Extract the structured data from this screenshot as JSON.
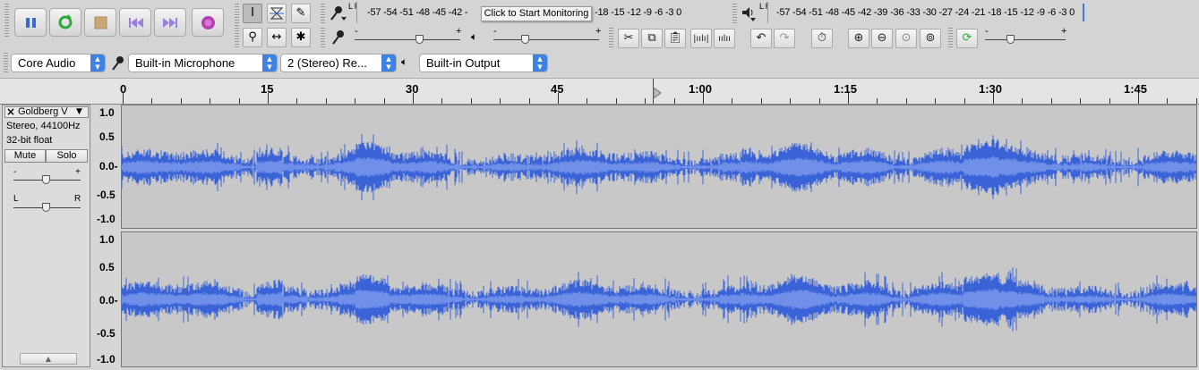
{
  "transport": {
    "pause_icon": "pause-icon",
    "play_icon": "loop-play-icon",
    "stop_icon": "stop-icon",
    "skip_start_icon": "skip-to-start-icon",
    "skip_end_icon": "skip-to-end-icon",
    "record_icon": "record-icon"
  },
  "record_meter": {
    "scale": "-57 -54 -51 -48 -45 -42 -",
    "scale_right": "-18 -15 -12 -9 -6 -3 0",
    "tooltip": "Click to Start Monitoring",
    "lr": "L R"
  },
  "play_meter": {
    "scale": "-57 -54 -51 -48 -45 -42 -39 -36 -33 -30 -27 -24 -21 -18 -15 -12 -9 -6 -3 0",
    "lr": "L R"
  },
  "mixer": {
    "minus": "-",
    "plus": "+"
  },
  "device": {
    "host": "Core Audio",
    "input": "Built-in Microphone",
    "channels": "2 (Stereo) Re...",
    "output": "Built-in Output"
  },
  "ruler": {
    "labels": [
      "0",
      "15",
      "30",
      "45",
      "1:00",
      "1:15",
      "1:30",
      "1:45"
    ]
  },
  "track": {
    "name": "Goldberg V",
    "close": "×",
    "info1": "Stereo, 44100Hz",
    "info2": "32-bit float",
    "mute": "Mute",
    "solo": "Solo",
    "gain_minus": "-",
    "gain_plus": "+",
    "pan_left": "L",
    "pan_right": "R",
    "scale": [
      "1.0",
      "0.5",
      "0.0-",
      "-0.5",
      "-1.0"
    ],
    "wave_color": "#3b63d8"
  }
}
